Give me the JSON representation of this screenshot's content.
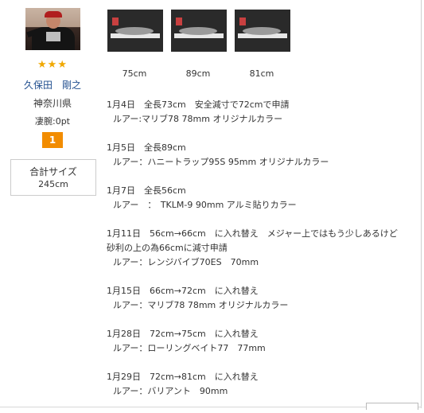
{
  "profile": {
    "stars": "★★★",
    "name": "久保田　剛之",
    "prefecture": "神奈川県",
    "skill": "凄腕:0pt",
    "rank": "1",
    "total_label": "合計サイズ",
    "total_value": "245cm"
  },
  "photos": [
    {
      "size": "75cm"
    },
    {
      "size": "89cm"
    },
    {
      "size": "81cm"
    }
  ],
  "entries": [
    {
      "lines": [
        "1月4日　全長73cm　安全減寸で72cmで申請"
      ],
      "lure": "ルアー:マリブ78 78mm オリジナルカラー"
    },
    {
      "lines": [
        "1月5日　全長89cm"
      ],
      "lure": "ルアー：ハニートラップ95S 95mm オリジナルカラー"
    },
    {
      "lines": [
        "1月7日　全長56cm"
      ],
      "lure": "ルアー　：　TKLM-9 90mm アルミ貼りカラー"
    },
    {
      "lines": [
        "1月11日　56cm→66cm　に入れ替え　メジャー上ではもう少しあるけど",
        "砂利の上の為66cmに減寸申請"
      ],
      "lure": "ルアー：レンジバイブ70ES　70mm"
    },
    {
      "lines": [
        "1月15日　66cm→72cm　に入れ替え"
      ],
      "lure": "ルアー：マリブ78 78mm オリジナルカラー"
    },
    {
      "lines": [
        "1月28日　72cm→75cm　に入れ替え"
      ],
      "lure": "ルアー：ローリングベイト77　77mm"
    },
    {
      "lines": [
        "1月29日　72cm→81cm　に入れ替え"
      ],
      "lure": "ルアー：バリアント　90mm"
    }
  ]
}
